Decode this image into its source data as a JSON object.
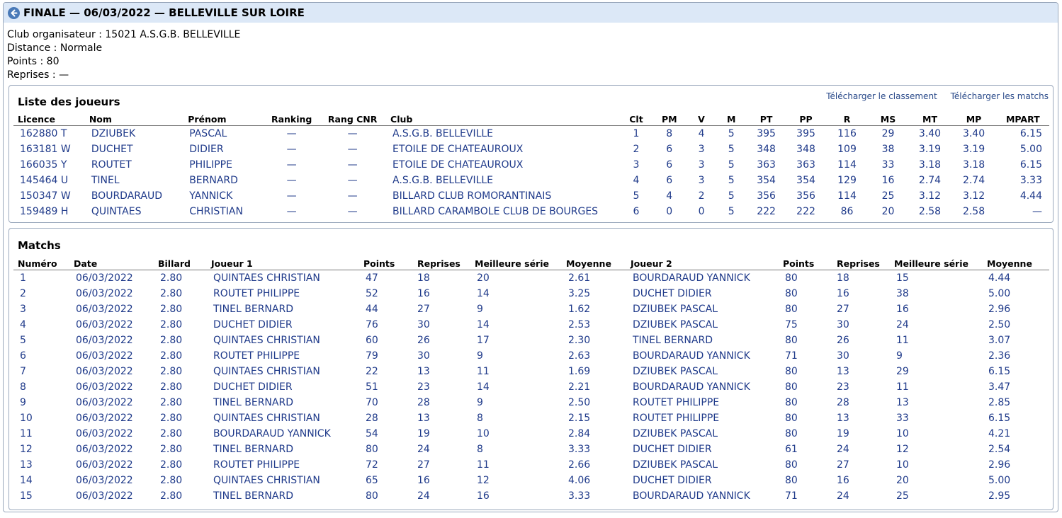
{
  "header": {
    "title": "FINALE — 06/03/2022 — BELLEVILLE SUR LOIRE"
  },
  "info": {
    "club": "Club organisateur : 15021 A.S.G.B. BELLEVILLE",
    "distance": "Distance : Normale",
    "points": "Points : 80",
    "reprises": "Reprises : —"
  },
  "players_panel": {
    "title": "Liste des joueurs",
    "download_ranking": "Télécharger le classement",
    "download_matches": "Télécharger les matchs",
    "columns": [
      "Licence",
      "Nom",
      "Prénom",
      "Ranking",
      "Rang CNR",
      "Club",
      "Clt",
      "PM",
      "V",
      "M",
      "PT",
      "PP",
      "R",
      "MS",
      "MT",
      "MP",
      "MPART"
    ],
    "rows": [
      [
        "162880 T",
        "DZIUBEK",
        "PASCAL",
        "—",
        "—",
        "A.S.G.B. BELLEVILLE",
        "1",
        "8",
        "4",
        "5",
        "395",
        "395",
        "116",
        "29",
        "3.40",
        "3.40",
        "6.15"
      ],
      [
        "163181 W",
        "DUCHET",
        "DIDIER",
        "—",
        "—",
        "ETOILE DE CHATEAUROUX",
        "2",
        "6",
        "3",
        "5",
        "348",
        "348",
        "109",
        "38",
        "3.19",
        "3.19",
        "5.00"
      ],
      [
        "166035 Y",
        "ROUTET",
        "PHILIPPE",
        "—",
        "—",
        "ETOILE DE CHATEAUROUX",
        "3",
        "6",
        "3",
        "5",
        "363",
        "363",
        "114",
        "33",
        "3.18",
        "3.18",
        "6.15"
      ],
      [
        "145464 U",
        "TINEL",
        "BERNARD",
        "—",
        "—",
        "A.S.G.B. BELLEVILLE",
        "4",
        "6",
        "3",
        "5",
        "354",
        "354",
        "129",
        "16",
        "2.74",
        "2.74",
        "3.33"
      ],
      [
        "150347 W",
        "BOURDARAUD",
        "YANNICK",
        "—",
        "—",
        "BILLARD CLUB ROMORANTINAIS",
        "5",
        "4",
        "2",
        "5",
        "356",
        "356",
        "114",
        "25",
        "3.12",
        "3.12",
        "4.44"
      ],
      [
        "159489 H",
        "QUINTAES",
        "CHRISTIAN",
        "—",
        "—",
        "BILLARD CARAMBOLE CLUB DE BOURGES",
        "6",
        "0",
        "0",
        "5",
        "222",
        "222",
        "86",
        "20",
        "2.58",
        "2.58",
        "—"
      ]
    ]
  },
  "matches_panel": {
    "title": "Matchs",
    "columns": [
      "Numéro",
      "Date",
      "Billard",
      "Joueur 1",
      "Points",
      "Reprises",
      "Meilleure série",
      "Moyenne",
      "Joueur 2",
      "Points",
      "Reprises",
      "Meilleure série",
      "Moyenne"
    ],
    "rows": [
      [
        "1",
        "06/03/2022",
        "2.80",
        "QUINTAES CHRISTIAN",
        "47",
        "18",
        "20",
        "2.61",
        "BOURDARAUD YANNICK",
        "80",
        "18",
        "15",
        "4.44"
      ],
      [
        "2",
        "06/03/2022",
        "2.80",
        "ROUTET PHILIPPE",
        "52",
        "16",
        "14",
        "3.25",
        "DUCHET DIDIER",
        "80",
        "16",
        "38",
        "5.00"
      ],
      [
        "3",
        "06/03/2022",
        "2.80",
        "TINEL BERNARD",
        "44",
        "27",
        "9",
        "1.62",
        "DZIUBEK PASCAL",
        "80",
        "27",
        "16",
        "2.96"
      ],
      [
        "4",
        "06/03/2022",
        "2.80",
        "DUCHET DIDIER",
        "76",
        "30",
        "14",
        "2.53",
        "DZIUBEK PASCAL",
        "75",
        "30",
        "24",
        "2.50"
      ],
      [
        "5",
        "06/03/2022",
        "2.80",
        "QUINTAES CHRISTIAN",
        "60",
        "26",
        "17",
        "2.30",
        "TINEL BERNARD",
        "80",
        "26",
        "11",
        "3.07"
      ],
      [
        "6",
        "06/03/2022",
        "2.80",
        "ROUTET PHILIPPE",
        "79",
        "30",
        "9",
        "2.63",
        "BOURDARAUD YANNICK",
        "71",
        "30",
        "9",
        "2.36"
      ],
      [
        "7",
        "06/03/2022",
        "2.80",
        "QUINTAES CHRISTIAN",
        "22",
        "13",
        "11",
        "1.69",
        "DZIUBEK PASCAL",
        "80",
        "13",
        "29",
        "6.15"
      ],
      [
        "8",
        "06/03/2022",
        "2.80",
        "DUCHET DIDIER",
        "51",
        "23",
        "14",
        "2.21",
        "BOURDARAUD YANNICK",
        "80",
        "23",
        "11",
        "3.47"
      ],
      [
        "9",
        "06/03/2022",
        "2.80",
        "TINEL BERNARD",
        "70",
        "28",
        "9",
        "2.50",
        "ROUTET PHILIPPE",
        "80",
        "28",
        "13",
        "2.85"
      ],
      [
        "10",
        "06/03/2022",
        "2.80",
        "QUINTAES CHRISTIAN",
        "28",
        "13",
        "8",
        "2.15",
        "ROUTET PHILIPPE",
        "80",
        "13",
        "33",
        "6.15"
      ],
      [
        "11",
        "06/03/2022",
        "2.80",
        "BOURDARAUD YANNICK",
        "54",
        "19",
        "10",
        "2.84",
        "DZIUBEK PASCAL",
        "80",
        "19",
        "10",
        "4.21"
      ],
      [
        "12",
        "06/03/2022",
        "2.80",
        "TINEL BERNARD",
        "80",
        "24",
        "8",
        "3.33",
        "DUCHET DIDIER",
        "61",
        "24",
        "12",
        "2.54"
      ],
      [
        "13",
        "06/03/2022",
        "2.80",
        "ROUTET PHILIPPE",
        "72",
        "27",
        "11",
        "2.66",
        "DZIUBEK PASCAL",
        "80",
        "27",
        "10",
        "2.96"
      ],
      [
        "14",
        "06/03/2022",
        "2.80",
        "QUINTAES CHRISTIAN",
        "65",
        "16",
        "12",
        "4.06",
        "DUCHET DIDIER",
        "80",
        "16",
        "20",
        "5.00"
      ],
      [
        "15",
        "06/03/2022",
        "2.80",
        "TINEL BERNARD",
        "80",
        "24",
        "16",
        "3.33",
        "BOURDARAUD YANNICK",
        "71",
        "24",
        "25",
        "2.95"
      ]
    ]
  }
}
